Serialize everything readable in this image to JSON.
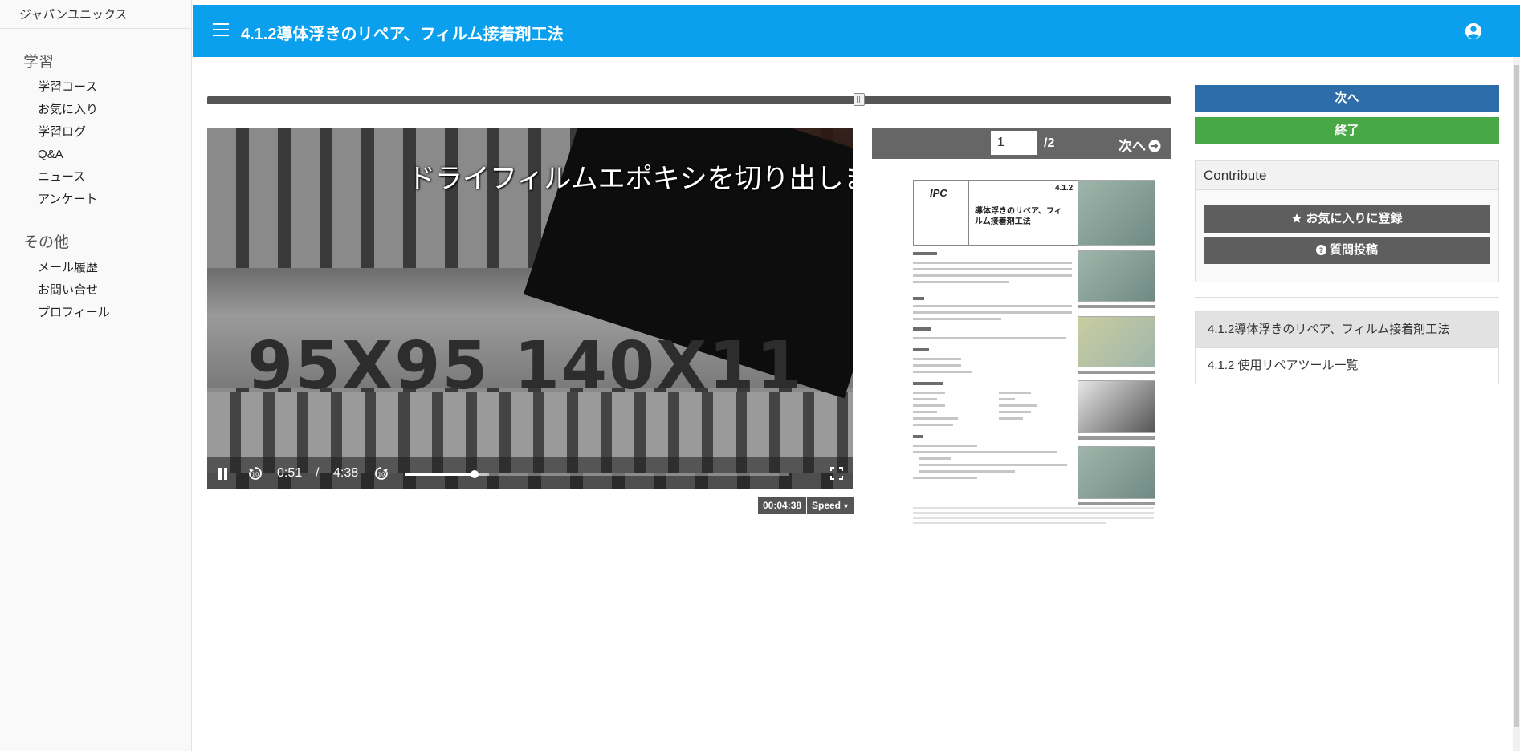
{
  "sidebar": {
    "brand": "ジャパンユニックス",
    "section1": "学習",
    "section1_items": [
      {
        "label": "学習コース"
      },
      {
        "label": "お気に入り"
      },
      {
        "label": "学習ログ"
      },
      {
        "label": "Q&A"
      },
      {
        "label": "ニュース"
      },
      {
        "label": "アンケート"
      }
    ],
    "section2": "その他",
    "section2_items": [
      {
        "label": "メール履歴"
      },
      {
        "label": "お問い合せ"
      },
      {
        "label": "プロフィール"
      }
    ]
  },
  "header": {
    "title": "4.1.2導体浮きのリペア、フィルム接着剤工法",
    "menu_icon": "hamburger-icon",
    "user_icon": "user-circle-icon",
    "color": "#0aa0ee"
  },
  "progress": {
    "fraction": 0.677
  },
  "video": {
    "subtitle": "ドライフィルムエポキシを切り出します",
    "chip_label": "95X95  140X11",
    "current_time": "0:51",
    "separator": "/",
    "duration": "4:38",
    "played_fraction": 0.183,
    "buffered_fraction": 0.22,
    "badge_duration": "00:04:38",
    "speed_label": "Speed",
    "state": "playing"
  },
  "document": {
    "page_value": "1",
    "page_total": "/2",
    "next_label": "次へ",
    "logo": "IPC",
    "page_id": "4.1.2",
    "title": "導体浮きのリペア、フィルム接着剤工法"
  },
  "actions": {
    "next_label": "次へ",
    "finish_label": "終了",
    "next_color": "#2d6da9",
    "finish_color": "#48a845"
  },
  "contribute": {
    "heading": "Contribute",
    "favorite_label": "お気に入りに登録",
    "question_label": "質問投稿"
  },
  "lessons": [
    {
      "label": "4.1.2導体浮きのリペア、フィルム接着剤工法",
      "active": true
    },
    {
      "label": "4.1.2 使用リペアツール一覧",
      "active": false
    }
  ]
}
